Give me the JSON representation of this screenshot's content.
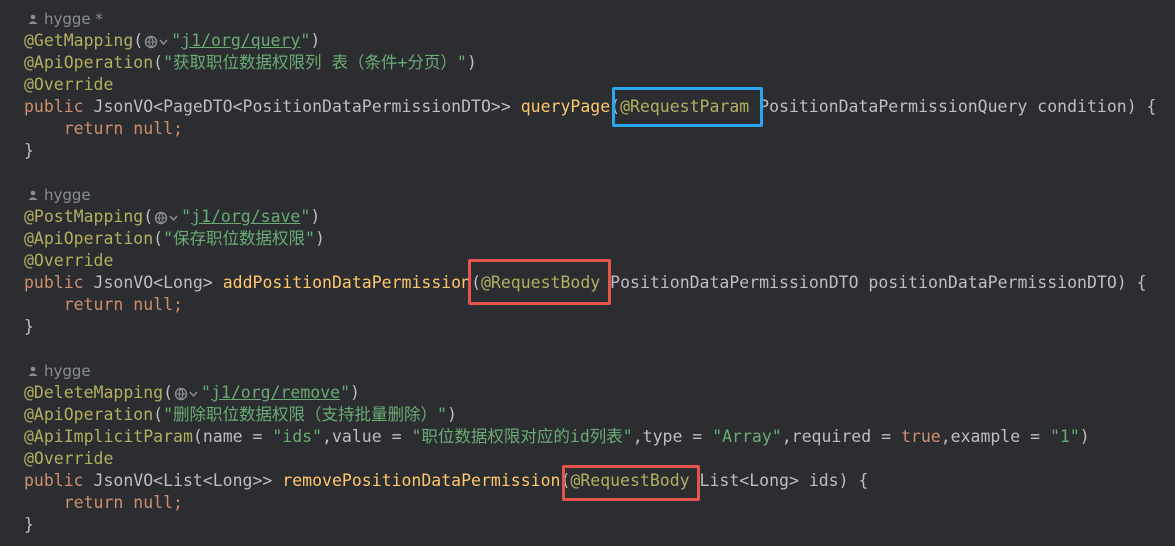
{
  "colors": {
    "background": "#2b2d30",
    "annotation": "#b3ae60",
    "keyword": "#cf8e6d",
    "string": "#6aab73",
    "method": "#ffc66d",
    "highlight_blue": "#2aa6ee",
    "highlight_red": "#e5534b"
  },
  "blocks": [
    {
      "author": "hygge *",
      "mapping": "@GetMapping",
      "url": "j1/org/query",
      "api_op_label": "@ApiOperation",
      "api_op_text": "\"获取职位数据权限列 表（条件+分页）\"",
      "override": "@Override",
      "kw_public": "public",
      "return_type": "JsonVO<PageDTO<PositionDataPermissionDTO>>",
      "method": "queryPage",
      "param_annotation": "@RequestParam",
      "param_rest": "PositionDataPermissionQuery condition) {",
      "kw_return": "return",
      "null_text": "null;",
      "close": "}"
    },
    {
      "author": "hygge",
      "mapping": "@PostMapping",
      "url": "j1/org/save",
      "api_op_label": "@ApiOperation",
      "api_op_text": "\"保存职位数据权限\"",
      "override": "@Override",
      "kw_public": "public",
      "return_type": "JsonVO<Long>",
      "method": "addPositionDataPermission",
      "param_annotation": "@RequestBody",
      "param_rest": "PositionDataPermissionDTO positionDataPermissionDTO) {",
      "kw_return": "return",
      "null_text": "null;",
      "close": "}"
    },
    {
      "author": "hygge",
      "mapping": "@DeleteMapping",
      "url": "j1/org/remove",
      "api_op_label": "@ApiOperation",
      "api_op_text": "\"删除职位数据权限（支持批量删除）\"",
      "implicit_label": "@ApiImplicitParam",
      "implicit_name_key": "name = ",
      "implicit_name_val": "\"ids\"",
      "implicit_value_key": ",value = ",
      "implicit_value_val": "\"职位数据权限对应的id列表\"",
      "implicit_type_key": ",type = ",
      "implicit_type_val": "\"Array\"",
      "implicit_required_key": ",required = ",
      "implicit_required_val": "true",
      "implicit_example_key": ",example = ",
      "implicit_example_val": "\"1\"",
      "override": "@Override",
      "kw_public": "public",
      "return_type": "JsonVO<List<Long>>",
      "method": "removePositionDataPermission",
      "param_annotation": "@RequestBody",
      "param_rest": "List<Long> ids) {",
      "kw_return": "return",
      "null_text": "null;",
      "close": "}"
    }
  ]
}
